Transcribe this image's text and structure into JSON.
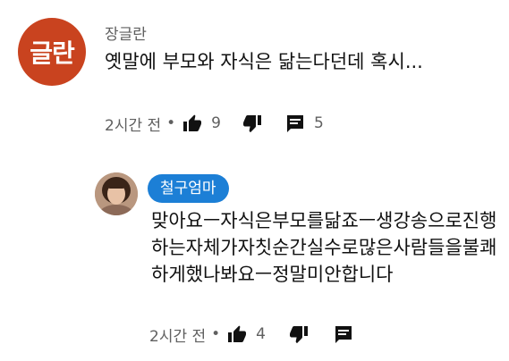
{
  "comment": {
    "avatar_text": "글란",
    "author": "장글란",
    "text": "옛말에 부모와 자식은 닮는다던데 혹시...",
    "time": "2시간 전",
    "separator": "•",
    "like_count": "9",
    "reply_count": "5"
  },
  "reply": {
    "author": "철구엄마",
    "text": "맞아요ㅡ자식은부모를닮죠ㅡ생강송으로진행하는자체가자칫순간실수로많은사람들을불쾌하게했나봐요ㅡ정말미안합니다",
    "time": "2시간 전",
    "separator": "•",
    "like_count": "4"
  },
  "colors": {
    "avatar_bg": "#c9431f",
    "author_chip_bg": "#1c7fd6",
    "meta_text": "#606060"
  },
  "icons": [
    "thumbs-up-icon",
    "thumbs-down-icon",
    "comment-icon"
  ]
}
